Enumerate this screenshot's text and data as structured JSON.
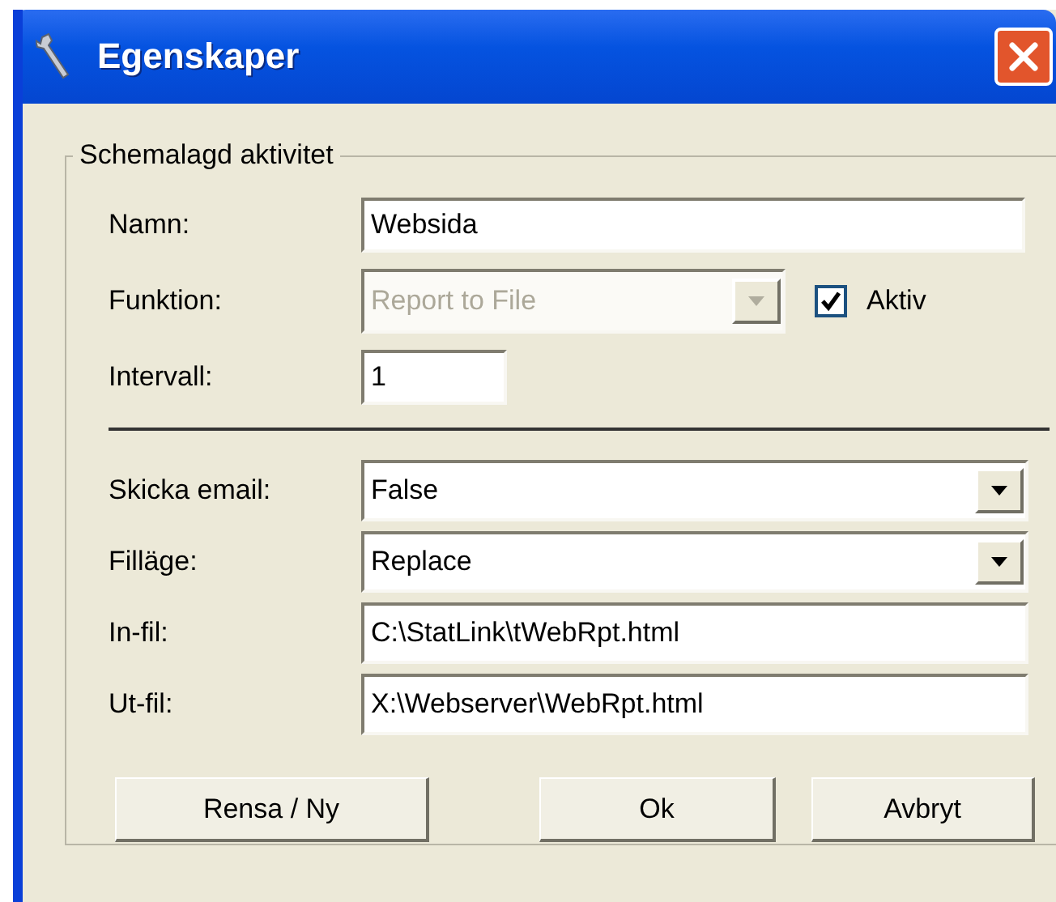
{
  "window": {
    "title": "Egenskaper"
  },
  "group": {
    "title": "Schemalagd aktivitet"
  },
  "top_fields": [
    {
      "label": "Namn:",
      "kind": "text",
      "value": "Websida",
      "disabled": false
    },
    {
      "label": "Funktion:",
      "kind": "combo",
      "value": "Report to File",
      "disabled": true
    },
    {
      "label": "Intervall:",
      "kind": "text",
      "value": "1",
      "disabled": false
    }
  ],
  "checkbox": {
    "label": "Aktiv",
    "checked": true
  },
  "bottom_fields": [
    {
      "label": "Skicka email:",
      "kind": "combo",
      "value": "False",
      "disabled": false
    },
    {
      "label": "Filläge:",
      "kind": "combo",
      "value": "Replace",
      "disabled": false
    },
    {
      "label": "In-fil:",
      "kind": "text",
      "value": "C:\\StatLink\\tWebRpt.html",
      "disabled": false
    },
    {
      "label": "Ut-fil:",
      "kind": "text",
      "value": "X:\\Webserver\\WebRpt.html",
      "disabled": false
    }
  ],
  "buttons": [
    "Rensa / Ny",
    "Ok",
    "Avbryt"
  ]
}
